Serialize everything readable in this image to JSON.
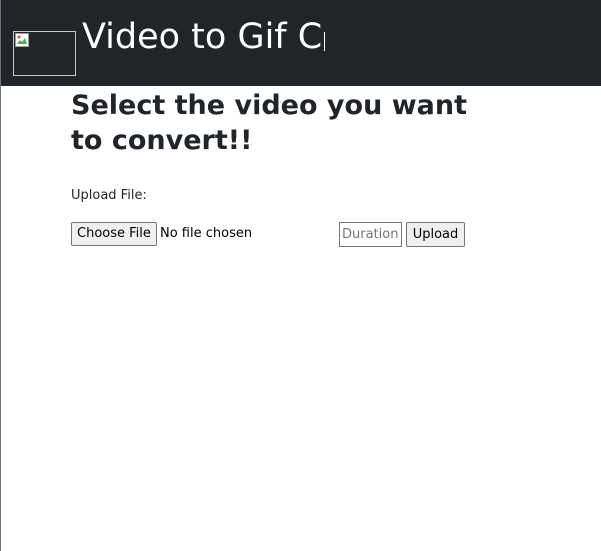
{
  "navbar": {
    "title": "Video to Gif C",
    "logo_icon": "broken-image-icon",
    "background_color": "#212529"
  },
  "main": {
    "heading": "Select the video you want to convert!!",
    "upload_label": "Upload File:",
    "file_input": {
      "button_label": "Choose File",
      "status": "No file chosen"
    },
    "duration_input": {
      "placeholder": "Duration",
      "value": ""
    },
    "upload_button_label": "Upload"
  }
}
